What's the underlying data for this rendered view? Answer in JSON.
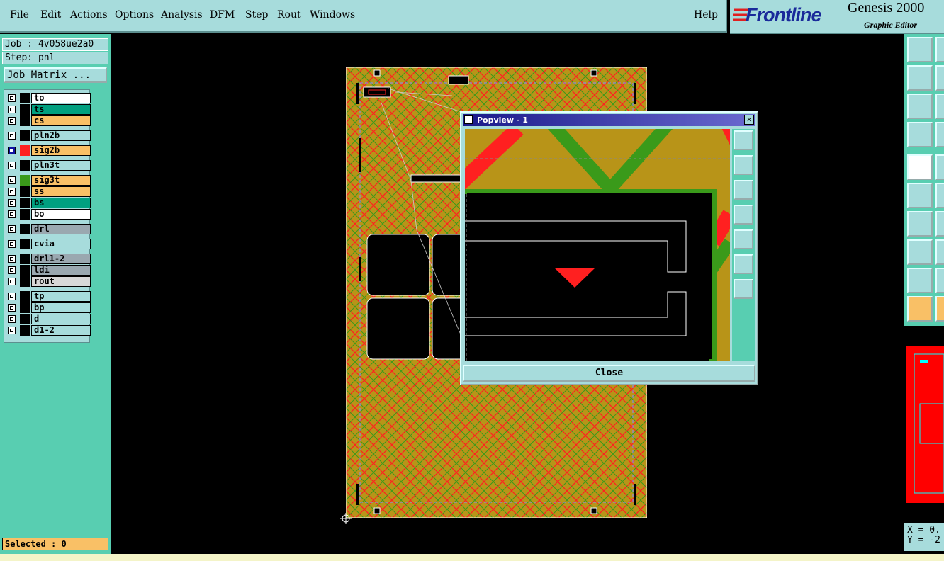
{
  "menu": {
    "file": "File",
    "edit": "Edit",
    "actions": "Actions",
    "options": "Options",
    "analysis": "Analysis",
    "dfm": "DFM",
    "step": "Step",
    "rout": "Rout",
    "windows": "Windows",
    "help": "Help"
  },
  "logo": {
    "brand": "Frontline",
    "product": "Genesis 2000",
    "subtitle": "Graphic Editor"
  },
  "info": {
    "job": "Job : 4v058ue2a0",
    "step": "Step: pnl",
    "job_matrix": "Job Matrix ...",
    "selected": "Selected : 0"
  },
  "layers": [
    {
      "name": "to",
      "color": "#ffffff",
      "bg": "#ffffff"
    },
    {
      "name": "ts",
      "color": "#00a080",
      "bg": "#00a080"
    },
    {
      "name": "cs",
      "color": "#f9c066",
      "bg": "#f9c066"
    },
    {
      "name": "pln2b",
      "color": "#a7dcdc",
      "bg": "#a7dcdc"
    },
    {
      "name": "sig2b",
      "color": "#ff2020",
      "bg": "#f9c066",
      "selected": true
    },
    {
      "name": "pln3t",
      "color": "#a7dcdc",
      "bg": "#a7dcdc"
    },
    {
      "name": "sig3t",
      "color": "#3a9a1a",
      "bg": "#f9c066"
    },
    {
      "name": "ss",
      "color": "#f9c066",
      "bg": "#f9c066"
    },
    {
      "name": "bs",
      "color": "#00a080",
      "bg": "#00a080"
    },
    {
      "name": "bo",
      "color": "#ffffff",
      "bg": "#ffffff"
    },
    {
      "name": "drl",
      "color": "#9aa8b0",
      "bg": "#9aa8b0"
    },
    {
      "name": "cvia",
      "color": "#a7dcdc",
      "bg": "#a7dcdc"
    },
    {
      "name": "drl1-2",
      "color": "#9aa8b0",
      "bg": "#9aa8b0"
    },
    {
      "name": "ldi",
      "color": "#9aa8b0",
      "bg": "#9aa8b0"
    },
    {
      "name": "rout",
      "color": "#d8d8d8",
      "bg": "#d8d8d8"
    },
    {
      "name": "tp",
      "color": "#a7dcdc",
      "bg": "#a7dcdc"
    },
    {
      "name": "bp",
      "color": "#a7dcdc",
      "bg": "#a7dcdc"
    },
    {
      "name": "d",
      "color": "#a7dcdc",
      "bg": "#a7dcdc"
    },
    {
      "name": "d1-2",
      "color": "#a7dcdc",
      "bg": "#a7dcdc"
    }
  ],
  "popview": {
    "title": "Popview - 1",
    "close_label": "Close",
    "close_x": "✕"
  },
  "coords": {
    "x": "X = 0.",
    "y": "Y = -2"
  }
}
